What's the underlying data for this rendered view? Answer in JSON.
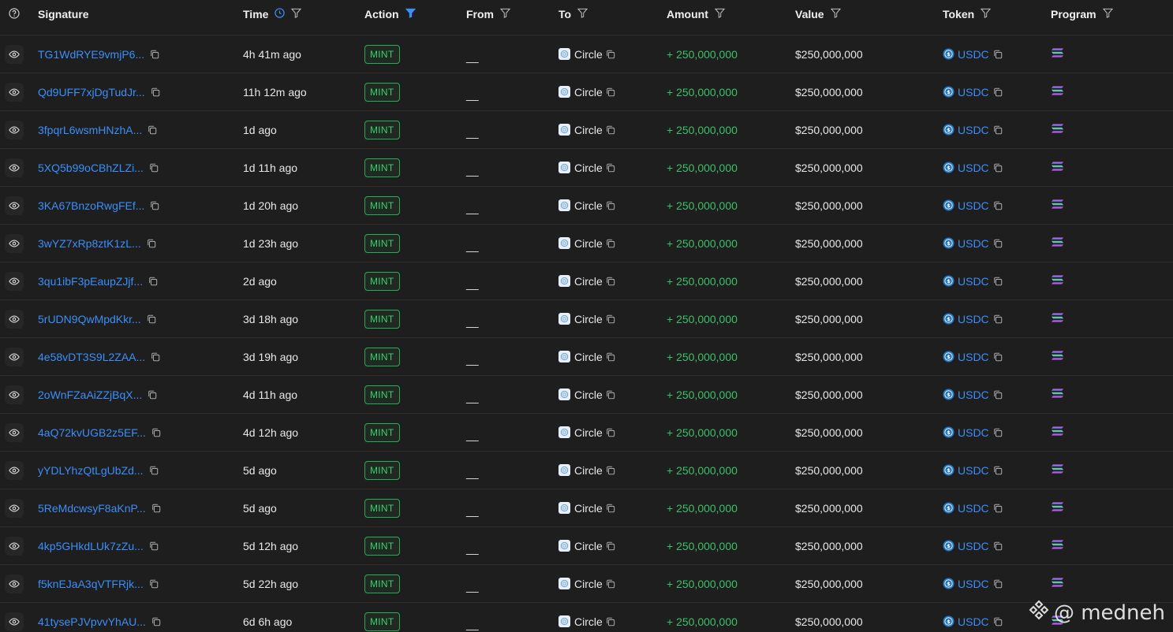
{
  "header": {
    "signature": "Signature",
    "time": "Time",
    "action": "Action",
    "from": "From",
    "to": "To",
    "amount": "Amount",
    "value": "Value",
    "token": "Token",
    "program": "Program"
  },
  "colors": {
    "link": "#3b8ff6",
    "amount_positive": "#3fbf6a",
    "mint_badge": "#2fa85a",
    "background": "#1e1e1e"
  },
  "icons": {
    "help": "question-circle-icon",
    "filter": "funnel-icon",
    "clock": "clock-icon",
    "view": "eye-icon",
    "copy": "copy-icon",
    "program": "solana-icon",
    "token": "usdc-icon",
    "to_avatar": "circle-logo-icon"
  },
  "rows": [
    {
      "signature": "TG1WdRYE9vmjP6...",
      "time": "4h 41m ago",
      "action": "MINT",
      "from": "__",
      "to": "Circle",
      "amount": "+ 250,000,000",
      "value": "$250,000,000",
      "token": "USDC"
    },
    {
      "signature": "Qd9UFF7xjDgTudJr...",
      "time": "11h 12m ago",
      "action": "MINT",
      "from": "__",
      "to": "Circle",
      "amount": "+ 250,000,000",
      "value": "$250,000,000",
      "token": "USDC"
    },
    {
      "signature": "3fpqrL6wsmHNzhA...",
      "time": "1d ago",
      "action": "MINT",
      "from": "__",
      "to": "Circle",
      "amount": "+ 250,000,000",
      "value": "$250,000,000",
      "token": "USDC"
    },
    {
      "signature": "5XQ5b99oCBhZLZi...",
      "time": "1d 11h ago",
      "action": "MINT",
      "from": "__",
      "to": "Circle",
      "amount": "+ 250,000,000",
      "value": "$250,000,000",
      "token": "USDC"
    },
    {
      "signature": "3KA67BnzoRwgFEf...",
      "time": "1d 20h ago",
      "action": "MINT",
      "from": "__",
      "to": "Circle",
      "amount": "+ 250,000,000",
      "value": "$250,000,000",
      "token": "USDC"
    },
    {
      "signature": "3wYZ7xRp8ztK1zL...",
      "time": "1d 23h ago",
      "action": "MINT",
      "from": "__",
      "to": "Circle",
      "amount": "+ 250,000,000",
      "value": "$250,000,000",
      "token": "USDC"
    },
    {
      "signature": "3qu1ibF3pEaupZJjf...",
      "time": "2d ago",
      "action": "MINT",
      "from": "__",
      "to": "Circle",
      "amount": "+ 250,000,000",
      "value": "$250,000,000",
      "token": "USDC"
    },
    {
      "signature": "5rUDN9QwMpdKkr...",
      "time": "3d 18h ago",
      "action": "MINT",
      "from": "__",
      "to": "Circle",
      "amount": "+ 250,000,000",
      "value": "$250,000,000",
      "token": "USDC"
    },
    {
      "signature": "4e58vDT3S9L2ZAA...",
      "time": "3d 19h ago",
      "action": "MINT",
      "from": "__",
      "to": "Circle",
      "amount": "+ 250,000,000",
      "value": "$250,000,000",
      "token": "USDC"
    },
    {
      "signature": "2oWnFZaAiZZjBqX...",
      "time": "4d 11h ago",
      "action": "MINT",
      "from": "__",
      "to": "Circle",
      "amount": "+ 250,000,000",
      "value": "$250,000,000",
      "token": "USDC"
    },
    {
      "signature": "4aQ72kvUGB2z5EF...",
      "time": "4d 12h ago",
      "action": "MINT",
      "from": "__",
      "to": "Circle",
      "amount": "+ 250,000,000",
      "value": "$250,000,000",
      "token": "USDC"
    },
    {
      "signature": "yYDLYhzQtLgUbZd...",
      "time": "5d ago",
      "action": "MINT",
      "from": "__",
      "to": "Circle",
      "amount": "+ 250,000,000",
      "value": "$250,000,000",
      "token": "USDC"
    },
    {
      "signature": "5ReMdcwsyF8aKnP...",
      "time": "5d ago",
      "action": "MINT",
      "from": "__",
      "to": "Circle",
      "amount": "+ 250,000,000",
      "value": "$250,000,000",
      "token": "USDC"
    },
    {
      "signature": "4kp5GHkdLUk7zZu...",
      "time": "5d 12h ago",
      "action": "MINT",
      "from": "__",
      "to": "Circle",
      "amount": "+ 250,000,000",
      "value": "$250,000,000",
      "token": "USDC"
    },
    {
      "signature": "f5knEJaA3qVTFRjk...",
      "time": "5d 22h ago",
      "action": "MINT",
      "from": "__",
      "to": "Circle",
      "amount": "+ 250,000,000",
      "value": "$250,000,000",
      "token": "USDC"
    },
    {
      "signature": "41tysePJVpvvYhAU...",
      "time": "6d 6h ago",
      "action": "MINT",
      "from": "__",
      "to": "Circle",
      "amount": "+ 250,000,000",
      "value": "$250,000,000",
      "token": "USDC"
    }
  ],
  "watermark": {
    "text": "@ medneh",
    "logo": "binance-square-logo"
  }
}
